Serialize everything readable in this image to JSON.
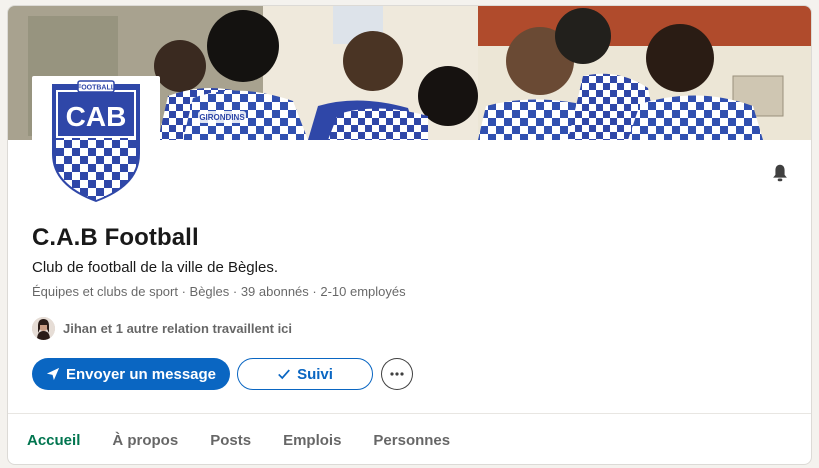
{
  "company": {
    "name": "C.A.B Football",
    "tagline": "Club de football de la ville de Bègles.",
    "meta": "Équipes et clubs de sport · Bègles · 39 abonnés · 2-10 employés",
    "connections_text": "Jihan et 1 autre relation travaillent ici",
    "logo": {
      "top_text": "FOOTBALL",
      "monogram": "CAB",
      "colors": {
        "primary": "#2f47a8",
        "secondary": "#ffffff"
      }
    },
    "cover": {
      "sponsor_text": "GIRONDINS",
      "jersey_colors": [
        "#2f47a8",
        "#ffffff"
      ]
    }
  },
  "actions": {
    "message_label": "Envoyer un message",
    "follow_label": "Suivi",
    "more_label": "···",
    "notification_icon": "bell-icon"
  },
  "tabs": [
    {
      "label": "Accueil",
      "active": true
    },
    {
      "label": "À propos",
      "active": false
    },
    {
      "label": "Posts",
      "active": false
    },
    {
      "label": "Emplois",
      "active": false
    },
    {
      "label": "Personnes",
      "active": false
    }
  ],
  "colors": {
    "brand_blue": "#0a66c2",
    "active_tab": "#01754f",
    "page_bg": "#f4f2ee"
  }
}
